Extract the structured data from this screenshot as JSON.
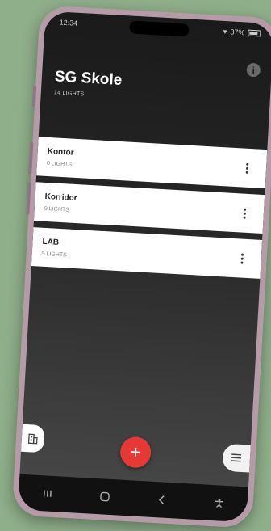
{
  "status": {
    "time": "12:34",
    "battery": "37%"
  },
  "header": {
    "title": "SG Skole",
    "subtitle": "14 LIGHTS"
  },
  "rooms": [
    {
      "name": "Kontor",
      "count": "0 LIGHTS"
    },
    {
      "name": "Korridor",
      "count": "9 LIGHTS"
    },
    {
      "name": "LAB",
      "count": "5 LIGHTS"
    }
  ],
  "icons": {
    "info": "info-icon",
    "more": "more-vertical-icon",
    "building": "building-icon",
    "add": "plus-icon",
    "menu": "menu-icon"
  },
  "colors": {
    "accent": "#e53935",
    "background": "#1a1a1a",
    "card": "#ffffff"
  },
  "glyphs": {
    "add": "+",
    "info": "i"
  }
}
